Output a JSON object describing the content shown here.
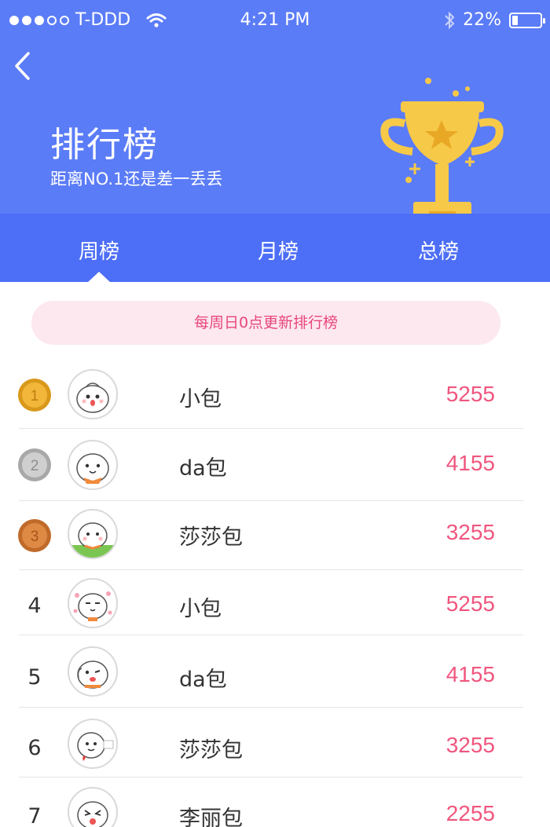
{
  "status_bar": {
    "carrier": "T-DDD",
    "time": "4:21 PM",
    "battery_text": "22%",
    "battery_level": 0.22
  },
  "header": {
    "title": "排行榜",
    "subtitle": "距离NO.1还是差一丢丢",
    "background_color": "#5b7cf7",
    "trophy_color": "#f7c948"
  },
  "tabs": [
    {
      "label": "周榜",
      "active": true
    },
    {
      "label": "月榜",
      "active": false
    },
    {
      "label": "总榜",
      "active": false
    }
  ],
  "notice": "每周日0点更新排行榜",
  "ranking": [
    {
      "rank": "1",
      "medal": "gold-medal-icon",
      "name": "小包",
      "score": "5255"
    },
    {
      "rank": "2",
      "medal": "silver-medal-icon",
      "name": "da包",
      "score": "4155"
    },
    {
      "rank": "3",
      "medal": "bronze-medal-icon",
      "name": "莎莎包",
      "score": "3255"
    },
    {
      "rank": "4",
      "medal": "",
      "name": "小包",
      "score": "5255"
    },
    {
      "rank": "5",
      "medal": "",
      "name": "da包",
      "score": "4155"
    },
    {
      "rank": "6",
      "medal": "",
      "name": "莎莎包",
      "score": "3255"
    },
    {
      "rank": "7",
      "medal": "",
      "name": "李丽包",
      "score": "2255"
    }
  ],
  "colors": {
    "tab_bar": "#4d6ef6",
    "score": "#f0567e",
    "notice_bg": "#fde8ef",
    "notice_text": "#e8467c"
  }
}
